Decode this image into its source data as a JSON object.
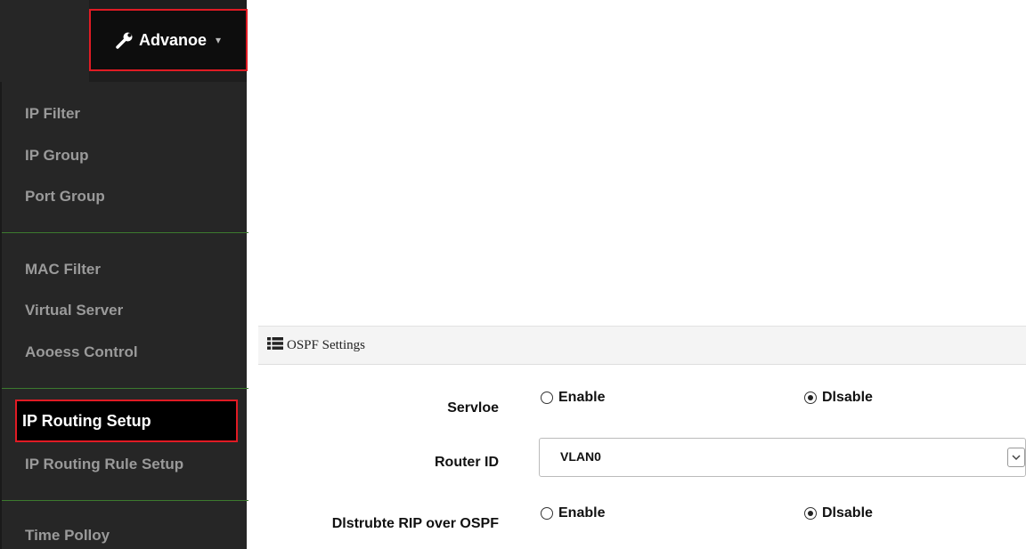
{
  "nav": {
    "advance_label": "Advanoe",
    "advance_icon": "wrench-icon",
    "caret_icon": "caret-down-icon",
    "items": [
      {
        "label": "IP Filter"
      },
      {
        "label": "IP Group"
      },
      {
        "label": "Port Group"
      },
      {
        "label": "MAC Filter"
      },
      {
        "label": "Virtual Server"
      },
      {
        "label": "Aooess Control"
      },
      {
        "label": "IP Routing Setup",
        "active": true
      },
      {
        "label": "IP Routing Rule Setup"
      },
      {
        "label": "Time Polloy"
      }
    ]
  },
  "panel": {
    "title": "OSPF Settings",
    "title_icon": "list-icon",
    "rows": [
      {
        "label": "Servloe",
        "type": "radio",
        "options": [
          "Enable",
          "Disable"
        ],
        "selected": "Disable",
        "option_labels": [
          "Enable",
          "Dlsable"
        ]
      },
      {
        "label": "Router ID",
        "type": "select",
        "value": "VLAN0"
      },
      {
        "label": "Dlstrubte RIP over OSPF",
        "type": "radio",
        "options": [
          "Enable",
          "Disable"
        ],
        "selected": "Disable",
        "option_labels": [
          "Enable",
          "Dlsable"
        ]
      }
    ]
  },
  "colors": {
    "menu_bg": "#262626",
    "highlight_border": "#e01b24",
    "divider": "#3c7a2e"
  }
}
